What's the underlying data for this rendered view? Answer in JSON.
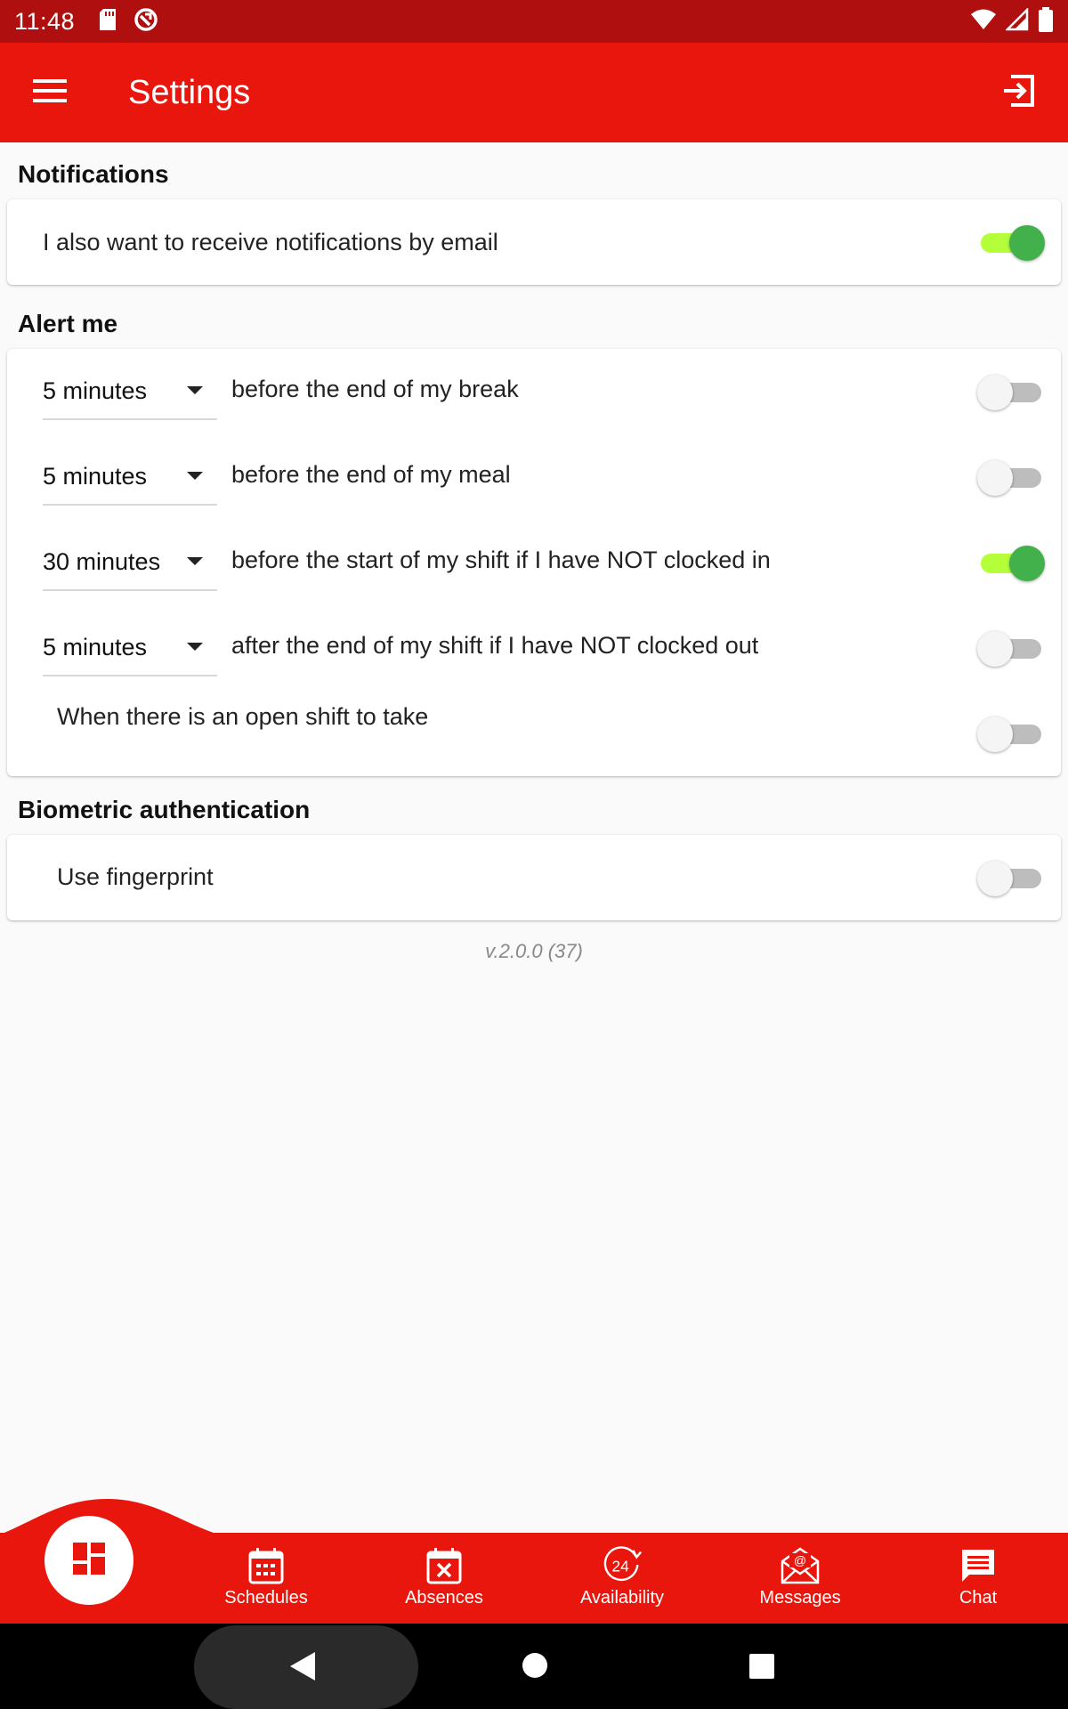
{
  "status_bar": {
    "time": "11:48"
  },
  "app_bar": {
    "title": "Settings"
  },
  "notifications": {
    "heading": "Notifications",
    "email_label": "I also want to receive notifications by email",
    "email_enabled": true
  },
  "alert_me": {
    "heading": "Alert me",
    "rows": [
      {
        "interval": "5 minutes",
        "label": "before the end of my break",
        "enabled": false
      },
      {
        "interval": "5 minutes",
        "label": "before the end of my meal",
        "enabled": false
      },
      {
        "interval": "30 minutes",
        "label": "before the start of my shift if I have NOT clocked in",
        "enabled": true
      },
      {
        "interval": "5 minutes",
        "label": "after the end of my shift if I have NOT clocked out",
        "enabled": false
      }
    ],
    "open_shift_label": "When there is an open shift to take",
    "open_shift_enabled": false
  },
  "biometric": {
    "heading": "Biometric authentication",
    "fingerprint_label": "Use fingerprint",
    "fingerprint_enabled": false
  },
  "version": "v.2.0.0 (37)",
  "bottom_nav": {
    "items": [
      {
        "label": "Schedules",
        "icon": "calendar-grid-icon"
      },
      {
        "label": "Absences",
        "icon": "calendar-x-icon"
      },
      {
        "label": "Availability",
        "icon": "24-hours-icon"
      },
      {
        "label": "Messages",
        "icon": "envelope-at-icon"
      },
      {
        "label": "Chat",
        "icon": "chat-bubble-icon"
      }
    ]
  },
  "colors": {
    "status_bar": "#b00f0f",
    "primary": "#e8160c",
    "switch_on_thumb": "#43b14b",
    "switch_on_track": "#b4ff3a",
    "switch_off_track": "#bdbdbd"
  }
}
